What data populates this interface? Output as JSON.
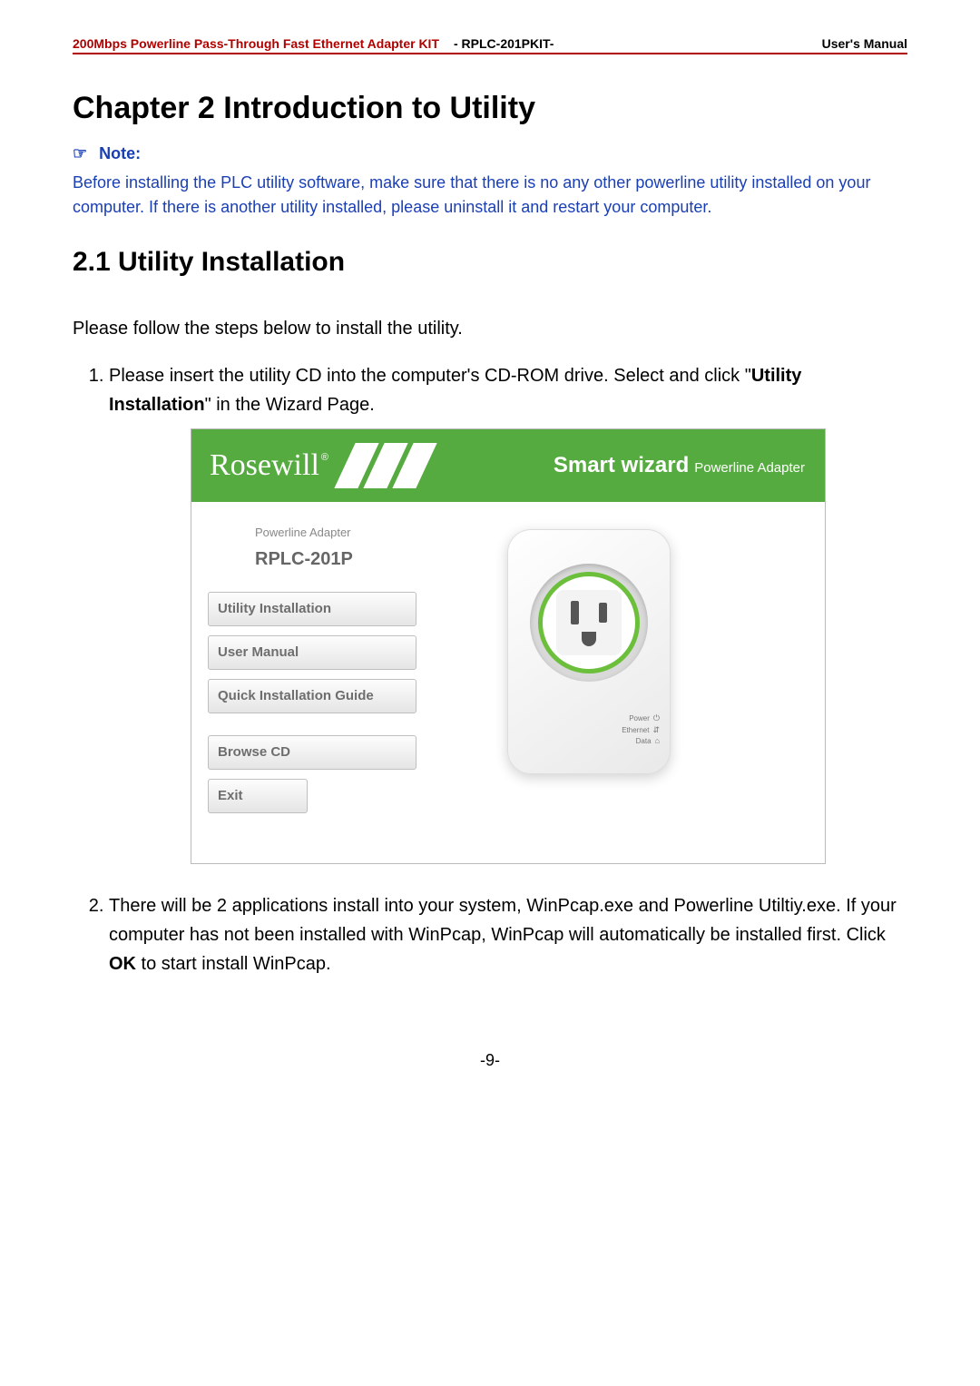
{
  "header": {
    "left": "200Mbps Powerline Pass-Through Fast Ethernet Adapter KIT",
    "mid": "- RPLC-201PKIT-",
    "right": "User's Manual"
  },
  "chapter_title": "Chapter 2 Introduction to Utility",
  "note": {
    "pointer": "☞",
    "label": "Note:",
    "body": "Before installing the PLC utility software, make sure that there is no any other powerline utility installed on your computer. If there is another utility installed, please uninstall it and restart your computer."
  },
  "section_title": "2.1 Utility Installation",
  "lead": "Please follow the steps below to install the utility.",
  "steps": {
    "s1_a": "Please insert the utility CD into the computer's CD-ROM drive. Select and click \"",
    "s1_bold": "Utility Installation",
    "s1_b": "\" in the Wizard Page.",
    "s2_a": "There will be 2 applications install into your system, WinPcap.exe and Powerline Utiltiy.exe. If your computer has not been installed with WinPcap, WinPcap will automatically be installed first. Click ",
    "s2_bold": "OK",
    "s2_b": " to start install WinPcap."
  },
  "wizard": {
    "brand": "Rosewill",
    "banner_title": "Smart wizard",
    "banner_sub": "Powerline Adapter",
    "product_small": "Powerline Adapter",
    "product_model": "RPLC-201P",
    "buttons": {
      "utility": "Utility Installation",
      "manual": "User Manual",
      "guide": "Quick Installation Guide",
      "browse": "Browse CD",
      "exit": "Exit"
    },
    "leds": {
      "power": "Power",
      "ethernet": "Ethernet",
      "data": "Data"
    }
  },
  "page_number": "-9-"
}
